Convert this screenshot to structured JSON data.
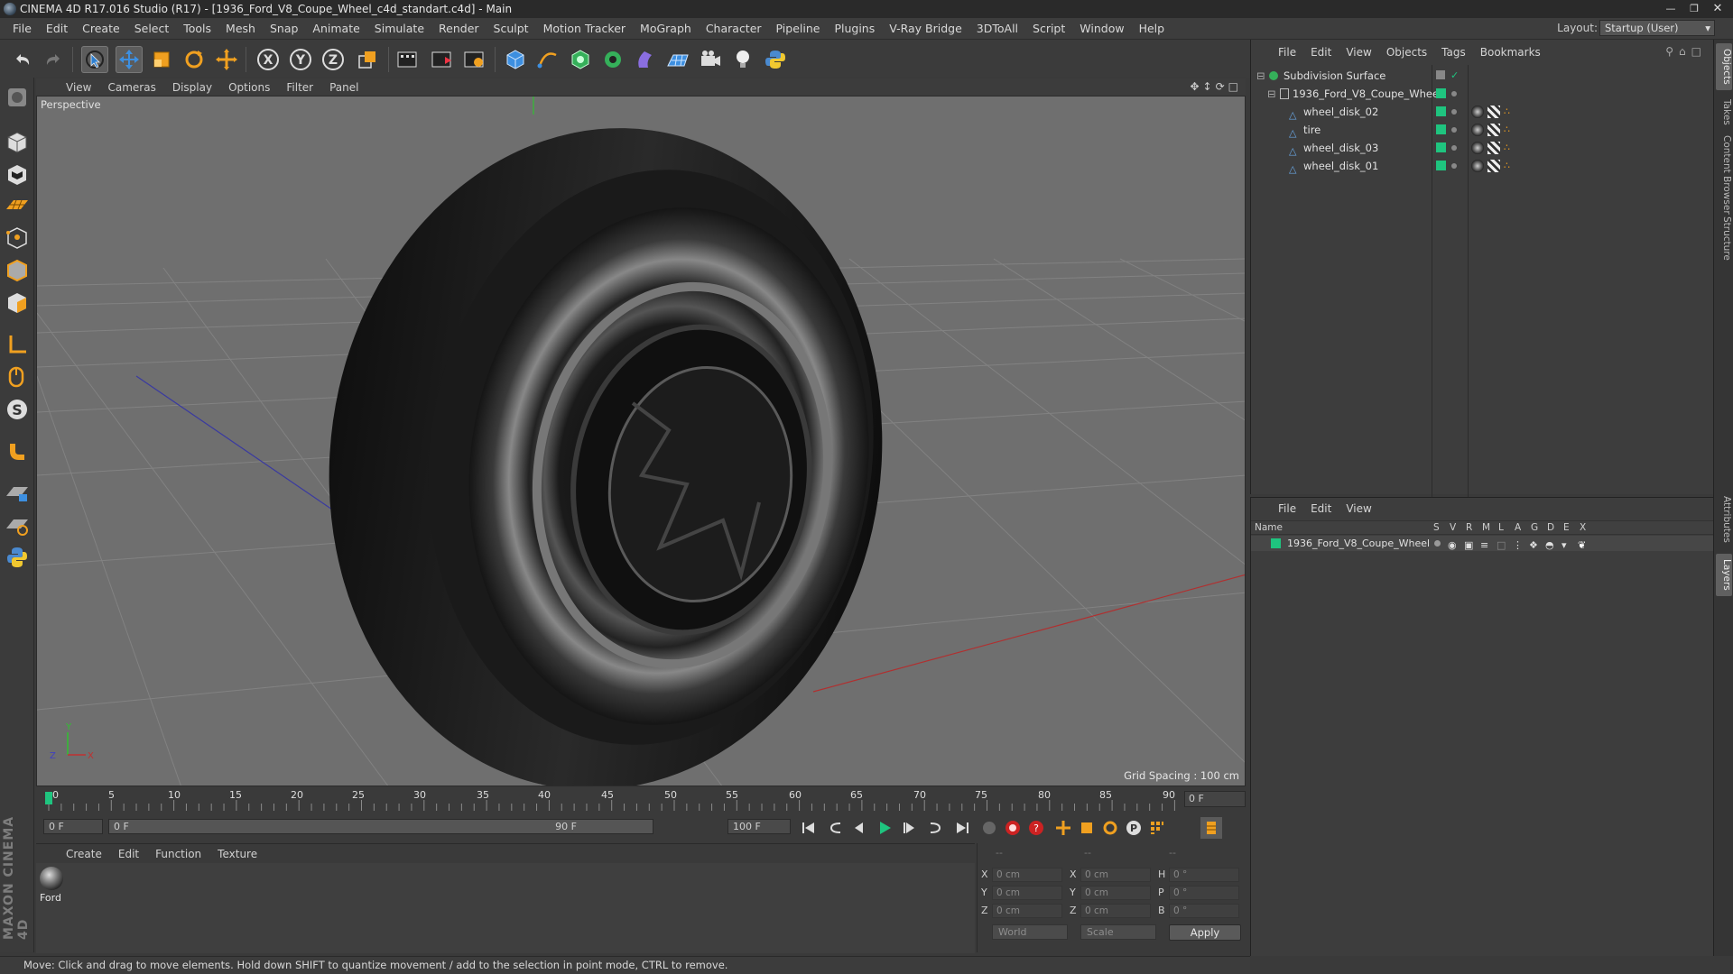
{
  "window": {
    "title": "CINEMA 4D R17.016 Studio (R17) - [1936_Ford_V8_Coupe_Wheel_c4d_standart.c4d] - Main"
  },
  "menu": [
    "File",
    "Edit",
    "Create",
    "Select",
    "Tools",
    "Mesh",
    "Snap",
    "Animate",
    "Simulate",
    "Render",
    "Sculpt",
    "Motion Tracker",
    "MoGraph",
    "Character",
    "Pipeline",
    "Plugins",
    "V-Ray Bridge",
    "3DToAll",
    "Script",
    "Window",
    "Help"
  ],
  "layout": {
    "label": "Layout:",
    "value": "Startup (User)"
  },
  "toolbar_icons": [
    "undo-icon",
    "redo-icon",
    "live-select-icon",
    "move-icon",
    "scale-icon",
    "rotate-icon",
    "last-tool-icon",
    "x-axis-icon",
    "y-axis-icon",
    "z-axis-icon",
    "coordinate-system-icon",
    "render-view-icon",
    "render-picture-viewer-icon",
    "edit-render-settings-icon",
    "cube-primitive-icon",
    "pen-spline-icon",
    "subdivision-surface-icon",
    "array-icon",
    "deformer-icon",
    "floor-icon",
    "camera-icon",
    "light-icon",
    "python-icon"
  ],
  "viewport": {
    "menu": [
      "View",
      "Cameras",
      "Display",
      "Options",
      "Filter",
      "Panel"
    ],
    "camera": "Perspective",
    "grid_spacing": "Grid Spacing : 100 cm"
  },
  "timeline": {
    "ticks": [
      "0",
      "5",
      "10",
      "15",
      "20",
      "25",
      "30",
      "35",
      "40",
      "45",
      "50",
      "55",
      "60",
      "65",
      "70",
      "75",
      "80",
      "85",
      "90"
    ],
    "current_frame": "0 F",
    "start": "0 F",
    "range_start": "0 F",
    "range_end": "90 F",
    "end": "100 F"
  },
  "material_manager": {
    "menu": [
      "Create",
      "Edit",
      "Function",
      "Texture"
    ],
    "materials": [
      {
        "name": "Ford"
      }
    ]
  },
  "coordinates": {
    "header": [
      "--",
      "--",
      "--"
    ],
    "rows": [
      {
        "a": "X",
        "av": "0 cm",
        "b": "X",
        "bv": "0 cm",
        "c": "H",
        "cv": "0 °"
      },
      {
        "a": "Y",
        "av": "0 cm",
        "b": "Y",
        "bv": "0 cm",
        "c": "P",
        "cv": "0 °"
      },
      {
        "a": "Z",
        "av": "0 cm",
        "b": "Z",
        "bv": "0 cm",
        "c": "B",
        "cv": "0 °"
      }
    ],
    "mode": "World",
    "scale": "Scale",
    "apply": "Apply"
  },
  "status": "Move: Click and drag to move elements. Hold down SHIFT to quantize movement / add to the selection in point mode, CTRL to remove.",
  "object_manager": {
    "menu": [
      "File",
      "Edit",
      "View",
      "Objects",
      "Tags",
      "Bookmarks"
    ],
    "objects": [
      {
        "name": "Subdivision Surface",
        "level": 0
      },
      {
        "name": "1936_Ford_V8_Coupe_Wheel",
        "level": 1
      },
      {
        "name": "wheel_disk_02",
        "level": 2
      },
      {
        "name": "tire",
        "level": 2
      },
      {
        "name": "wheel_disk_03",
        "level": 2
      },
      {
        "name": "wheel_disk_01",
        "level": 2
      }
    ]
  },
  "layer_manager": {
    "menu": [
      "File",
      "Edit",
      "View"
    ],
    "columns": [
      "Name",
      "S",
      "V",
      "R",
      "M",
      "L",
      "A",
      "G",
      "D",
      "E",
      "X"
    ],
    "layers": [
      {
        "name": "1936_Ford_V8_Coupe_Wheel",
        "color": "#1fc47f"
      }
    ]
  },
  "right_tabs": [
    "Objects",
    "Takes",
    "Content Browser",
    "Structure",
    "Attributes",
    "Layers"
  ],
  "colors": {
    "accent": "#1fc47f",
    "active_blue": "#2c7fd1"
  }
}
